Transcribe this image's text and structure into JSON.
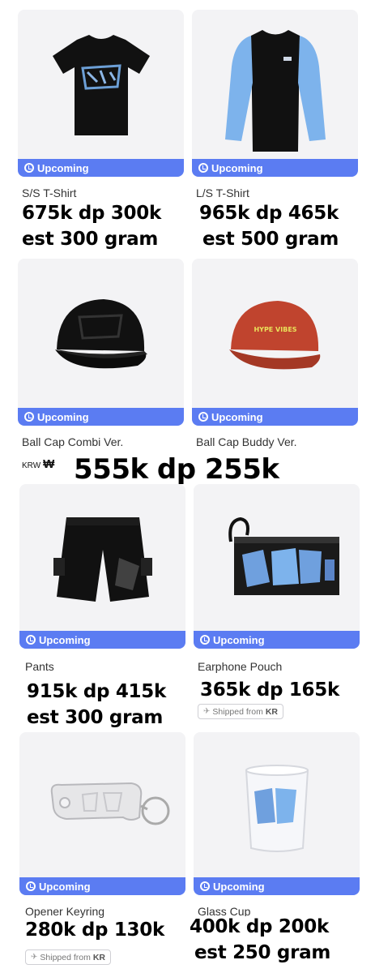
{
  "badge_label": "Upcoming",
  "colors": {
    "badge": "#5b7cf2",
    "card_bg": "#f3f3f5"
  },
  "products": [
    {
      "name": "S/S T-Shirt",
      "price": "675k dp 300k",
      "weight": "est 300 gram",
      "icon": "tshirt-icon"
    },
    {
      "name": "L/S T-Shirt",
      "price": "965k dp 465k",
      "weight": "est 500 gram",
      "icon": "longsleeve-icon"
    },
    {
      "name": "Ball Cap Combi Ver.",
      "icon": "black-cap-icon"
    },
    {
      "name": "Ball Cap Buddy Ver.",
      "icon": "red-cap-icon"
    },
    {
      "name": "Pants",
      "price": "915k dp 415k",
      "weight": "est 300 gram",
      "icon": "shorts-icon"
    },
    {
      "name": "Earphone Pouch",
      "price": "365k dp 165k",
      "shipped": "Shipped from",
      "shipped_origin": "KR",
      "icon": "pouch-icon"
    },
    {
      "name": "Opener Keyring",
      "price": "280k dp 130k",
      "shipped": "Shipped from",
      "shipped_origin": "KR",
      "icon": "keyring-icon"
    },
    {
      "name": "Glass Cup",
      "price": "400k dp 200k",
      "weight": "est 250 gram",
      "icon": "glass-icon"
    }
  ],
  "caps_price": "555k dp 255k",
  "krw_label": "KRW",
  "krw_symbol": "₩"
}
